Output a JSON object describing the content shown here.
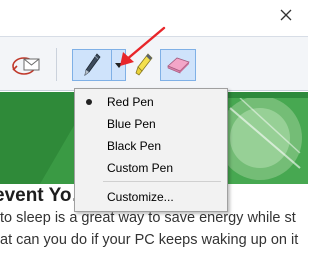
{
  "window": {
    "close_icon": "close-icon"
  },
  "toolbar": {
    "tools": [
      {
        "name": "share-mail",
        "icon": "envelope-share-icon"
      },
      {
        "name": "pen",
        "icon": "pen-icon"
      },
      {
        "name": "pen-dropdown",
        "icon": "caret-down-icon"
      },
      {
        "name": "highlighter",
        "icon": "highlighter-icon"
      },
      {
        "name": "eraser",
        "icon": "eraser-icon"
      }
    ]
  },
  "pen_menu": {
    "items": [
      {
        "label": "Red Pen",
        "selected": true
      },
      {
        "label": "Blue Pen",
        "selected": false
      },
      {
        "label": "Black Pen",
        "selected": false
      },
      {
        "label": "Custom Pen",
        "selected": false
      }
    ],
    "customize_label": "Customize..."
  },
  "article": {
    "headline": "event Yo… from Wa",
    "line1": "to sleep is a great way to save energy while st",
    "line2": "at can you do if your PC keeps waking up on it"
  },
  "colors": {
    "accent_arrow": "#e8262a",
    "toolbar_bg": "#f3f5f8",
    "selected_tool_bg": "#cfe3fb",
    "hero_green": "#3a9a44"
  }
}
